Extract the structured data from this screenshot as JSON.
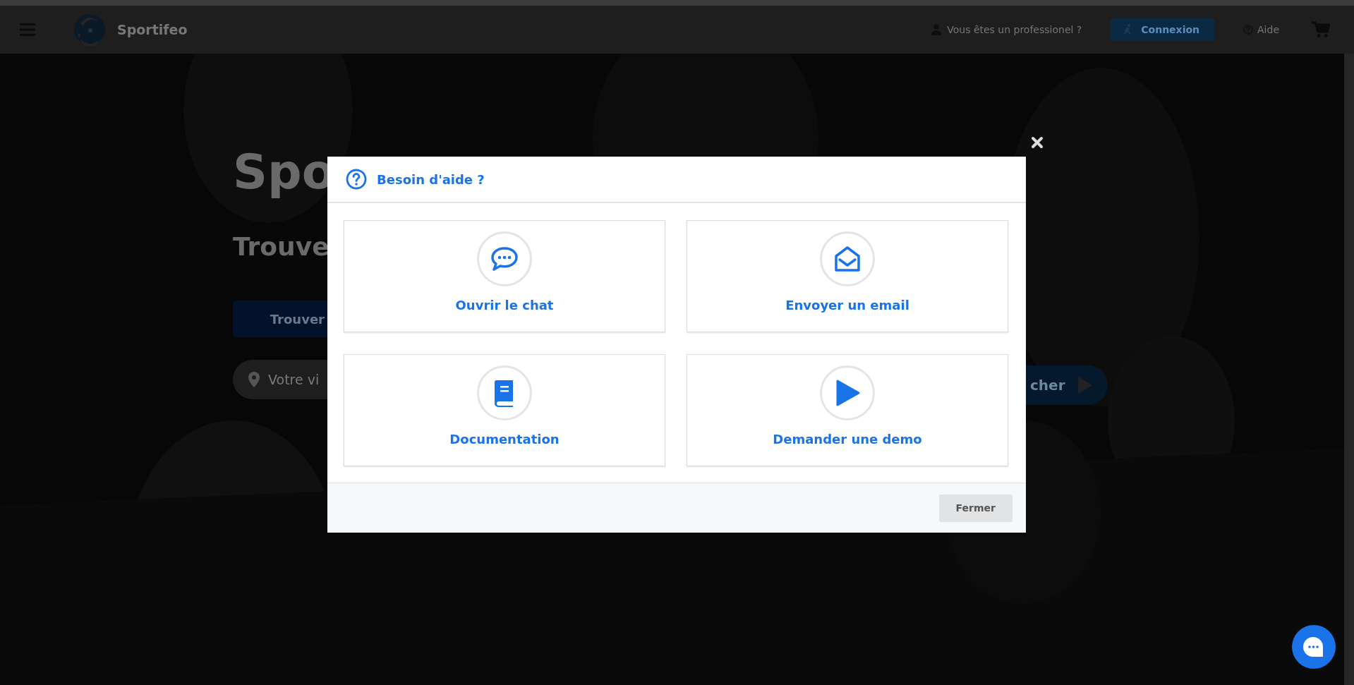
{
  "header": {
    "brand": "Sportifeo",
    "pro_link": "Vous êtes un professionel ?",
    "login_button": "Connexion",
    "help_link": "Aide"
  },
  "hero": {
    "title": "Spo",
    "subtitle": "Trouve",
    "cta_button": "Trouver",
    "search": {
      "placeholder": "Votre vi"
    },
    "search_button": "cher"
  },
  "modal": {
    "title": "Besoin d'aide ?",
    "options": [
      {
        "kind": "chat",
        "label": "Ouvrir le chat"
      },
      {
        "kind": "email",
        "label": "Envoyer un email"
      },
      {
        "kind": "docs",
        "label": "Documentation"
      },
      {
        "kind": "demo",
        "label": "Demander une demo"
      }
    ],
    "close_button": "Fermer"
  }
}
